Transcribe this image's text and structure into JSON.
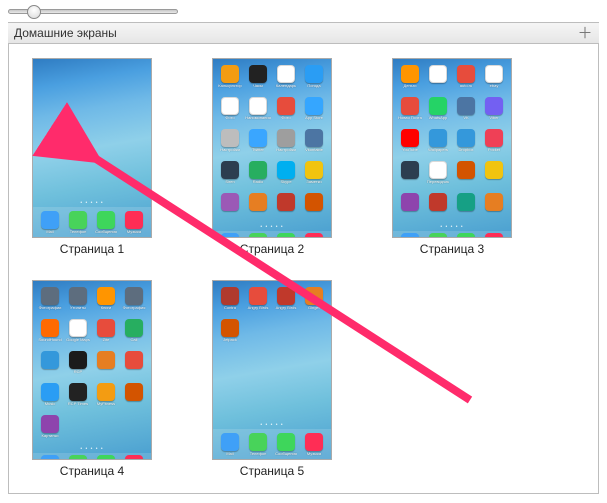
{
  "header": {
    "title": "Домашние экраны"
  },
  "dock": [
    {
      "label": "Mail",
      "color": "#3fa0f7"
    },
    {
      "label": "Телефон",
      "color": "#48d35a"
    },
    {
      "label": "Сообщения",
      "color": "#3ed65b"
    },
    {
      "label": "Музыка",
      "color": "#ff2d55"
    }
  ],
  "pages": [
    {
      "label": "Страница 1",
      "apps": []
    },
    {
      "label": "Страница 2",
      "apps": [
        {
          "label": "Калькулятор",
          "color": "#f39c12"
        },
        {
          "label": "Часы",
          "color": "#222222"
        },
        {
          "label": "Календарь",
          "color": "#ffffff"
        },
        {
          "label": "Погода",
          "color": "#2a9df4"
        },
        {
          "label": "Фото",
          "color": "#ffffff"
        },
        {
          "label": "Напоминания",
          "color": "#ffffff"
        },
        {
          "label": "Фото",
          "color": "#e74c3c"
        },
        {
          "label": "App Store",
          "color": "#35a6ff"
        },
        {
          "label": "Настройки",
          "color": "#bdbdbd"
        },
        {
          "label": "Twitter",
          "color": "#3aa6ff"
        },
        {
          "label": "Настройки",
          "color": "#9e9e9e"
        },
        {
          "label": "Vkontakte",
          "color": "#4c75a3"
        },
        {
          "label": "Siren",
          "color": "#2c3e50"
        },
        {
          "label": "Radio",
          "color": "#27ae60"
        },
        {
          "label": "Skype",
          "color": "#00aff0"
        },
        {
          "label": "Заметки",
          "color": "#f1c40f"
        },
        {
          "label": "",
          "color": "#9b59b6"
        },
        {
          "label": "",
          "color": "#e67e22"
        },
        {
          "label": "",
          "color": "#c0392b"
        },
        {
          "label": "",
          "color": "#d35400"
        }
      ]
    },
    {
      "label": "Страница 3",
      "apps": [
        {
          "label": "Деньги",
          "color": "#ff9500"
        },
        {
          "label": "",
          "color": "#ffffff"
        },
        {
          "label": "auto.ru",
          "color": "#e74c3c"
        },
        {
          "label": "ebay",
          "color": "#ffffff"
        },
        {
          "label": "Новая Почта",
          "color": "#e74c3c"
        },
        {
          "label": "WhatsApp",
          "color": "#25d366"
        },
        {
          "label": "VK",
          "color": "#4c75a3"
        },
        {
          "label": "Viber",
          "color": "#7360f2"
        },
        {
          "label": "YouTube",
          "color": "#ff0000"
        },
        {
          "label": "Wallpapers",
          "color": "#3498db"
        },
        {
          "label": "Dropbox",
          "color": "#3498db"
        },
        {
          "label": "Pocket",
          "color": "#ef4056"
        },
        {
          "label": "",
          "color": "#2c3e50"
        },
        {
          "label": "Переводчик",
          "color": "#ffffff"
        },
        {
          "label": "",
          "color": "#d35400"
        },
        {
          "label": "",
          "color": "#f1c40f"
        },
        {
          "label": "",
          "color": "#8e44ad"
        },
        {
          "label": "",
          "color": "#c0392b"
        },
        {
          "label": "",
          "color": "#16a085"
        },
        {
          "label": "",
          "color": "#e67e22"
        }
      ]
    },
    {
      "label": "Страница 4",
      "apps": [
        {
          "label": "Фотографии",
          "color": "#5d6d7e"
        },
        {
          "label": "Утилиты",
          "color": "#5d6d7e"
        },
        {
          "label": "Книги",
          "color": "#ff9500"
        },
        {
          "label": "Фотография",
          "color": "#5d6d7e"
        },
        {
          "label": "SoundHound",
          "color": "#ff6a00"
        },
        {
          "label": "Google Maps",
          "color": "#ffffff"
        },
        {
          "label": "Zite",
          "color": "#e74c3c"
        },
        {
          "label": "Call",
          "color": "#27ae60"
        },
        {
          "label": "",
          "color": "#3498db"
        },
        {
          "label": "RCP",
          "color": "#1b1b1b"
        },
        {
          "label": "",
          "color": "#e67e22"
        },
        {
          "label": "",
          "color": "#e74c3c"
        },
        {
          "label": "Music",
          "color": "#2a9df4"
        },
        {
          "label": "RCP Times",
          "color": "#222222"
        },
        {
          "label": "MyFitness",
          "color": "#f39c12"
        },
        {
          "label": "",
          "color": "#d35400"
        },
        {
          "label": "Картинки",
          "color": "#8e44ad"
        }
      ]
    },
    {
      "label": "Страница 5",
      "apps": [
        {
          "label": "Contra",
          "color": "#b03a2e"
        },
        {
          "label": "Angry Birds",
          "color": "#e74c3c"
        },
        {
          "label": "Angry Birds",
          "color": "#c0392b"
        },
        {
          "label": "Ginger",
          "color": "#e67e22"
        },
        {
          "label": "Jetpack",
          "color": "#d35400"
        }
      ]
    }
  ]
}
